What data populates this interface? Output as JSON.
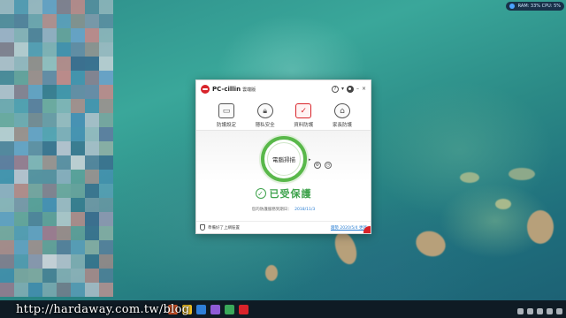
{
  "watermark": "http://hardaway.com.tw/blog",
  "system_widget": "RAM: 33% CPU: 5%",
  "app": {
    "brand": "PC-cillin",
    "edition": "雲端版",
    "help_icon": "question-icon",
    "features": [
      {
        "label": "防護設定",
        "icon": "monitor-icon",
        "active": false
      },
      {
        "label": "隱私安全",
        "icon": "lock-icon",
        "active": false
      },
      {
        "label": "資料防護",
        "icon": "checkmark-icon",
        "active": true
      },
      {
        "label": "家長防護",
        "icon": "home-icon",
        "active": false
      }
    ],
    "scan_label": "電腦掃描",
    "status": "已受保護",
    "expiry_label": "您的防護服務到期日：",
    "expiry_date": "2018/11/3",
    "footer_left": "準備好了上網裝置",
    "footer_right": "趨勢 2020/5/4 更新"
  },
  "colors": {
    "accent_red": "#d8232a",
    "status_green": "#3fa34d",
    "link_blue": "#2a7fd4",
    "taskbar": "#0f1b24"
  }
}
